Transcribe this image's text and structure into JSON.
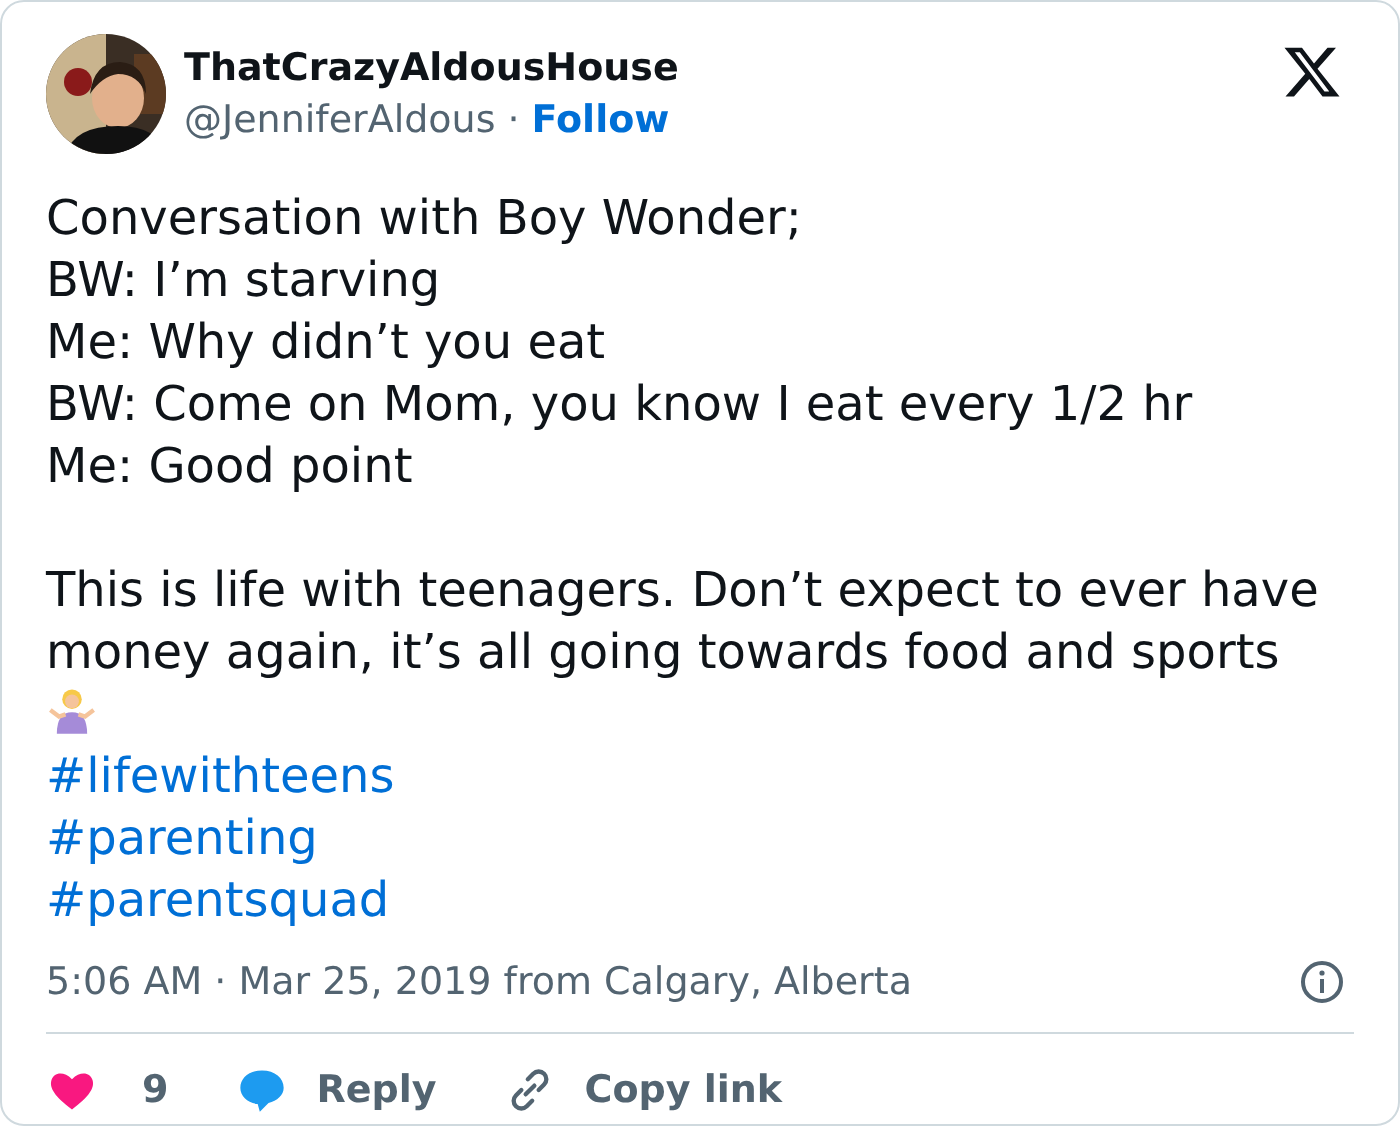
{
  "author": {
    "name": "ThatCrazyAldousHouse",
    "handle": "@JenniferAldous",
    "separator": "·",
    "follow": "Follow"
  },
  "lines": [
    "Conversation with Boy Wonder;",
    "BW: I’m starving",
    "Me: Why didn’t you eat",
    "BW: Come on Mom, you know I eat every 1/2 hr",
    "Me: Good point"
  ],
  "paragraph": "This is life with teenagers. Don’t expect to ever have money again, it’s all going towards food and sports",
  "hashtags": [
    "#lifewithteens",
    "#parenting",
    "#parentsquad"
  ],
  "meta": "5:06 AM · Mar 25, 2019 from Calgary, Alberta",
  "actions": {
    "likes": "9",
    "reply": "Reply",
    "copy": "Copy link"
  }
}
